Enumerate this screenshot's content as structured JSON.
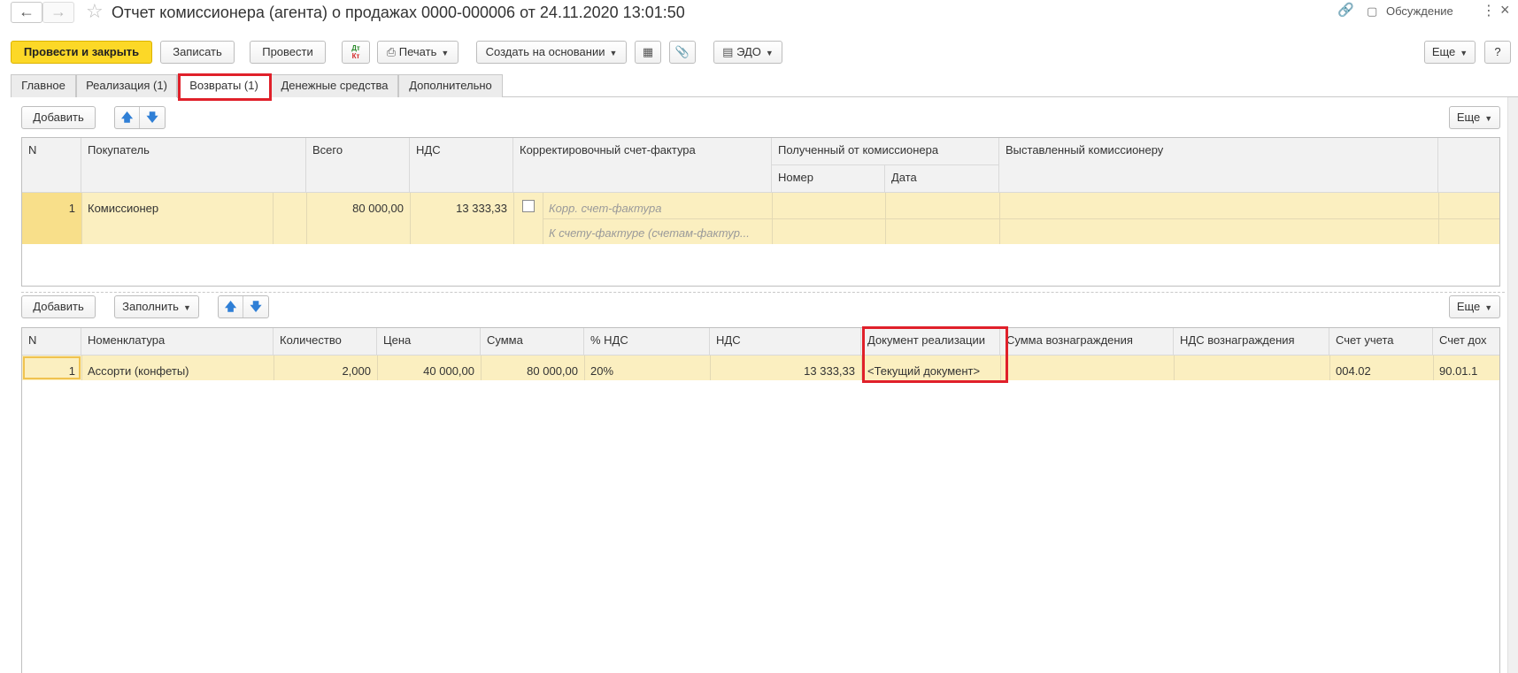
{
  "window": {
    "title": "Отчет комиссионера (агента) о продажах 0000-000006 от 24.11.2020 13:01:50",
    "back_icon": "arrow-left-icon",
    "forward_icon": "arrow-right-icon",
    "favorite_icon": "star-icon",
    "link_icon": "link-icon",
    "discussion_label": "Обсуждение",
    "menu_icon": "vertical-dots-icon",
    "close_icon": "close-icon"
  },
  "toolbar": {
    "post_close_label": "Провести и закрыть",
    "save_label": "Записать",
    "post_label": "Провести",
    "dtkt_icon": "dt-kt-icon",
    "dt_text": "Дт",
    "kt_text": "Кт",
    "print_label": "Печать",
    "create_based_label": "Создать на основании",
    "structure_icon": "structure-icon",
    "attach_icon": "paperclip-icon",
    "edo_label": "ЭДО",
    "more_label": "Еще",
    "help_label": "?"
  },
  "tabs": [
    {
      "label": "Главное"
    },
    {
      "label": "Реализация (1)"
    },
    {
      "label": "Возвраты (1)",
      "active": true
    },
    {
      "label": "Денежные средства"
    },
    {
      "label": "Дополнительно"
    }
  ],
  "returns_panel": {
    "add_label": "Добавить",
    "more_label": "Еще",
    "up_icon": "arrow-up-icon",
    "down_icon": "arrow-down-icon",
    "headers": {
      "n": "N",
      "buyer": "Покупатель",
      "total": "Всего",
      "vat": "НДС",
      "corr_invoice": "Корректировочный счет-фактура",
      "received": "Полученный от комиссионера",
      "number": "Номер",
      "date": "Дата",
      "issued": "Выставленный комиссионеру"
    },
    "rows": [
      {
        "n": "1",
        "buyer": "Комиссионер",
        "total": "80 000,00",
        "vat": "13 333,33",
        "corr_invoice_placeholder": "Корр. счет-фактура",
        "to_invoice_placeholder": "К счету-фактуре (счетам-фактур..."
      }
    ]
  },
  "goods_panel": {
    "add_label": "Добавить",
    "fill_label": "Заполнить",
    "more_label": "Еще",
    "headers": {
      "n": "N",
      "item": "Номенклатура",
      "qty": "Количество",
      "price": "Цена",
      "sum": "Сумма",
      "vat_rate": "% НДС",
      "vat": "НДС",
      "sale_doc": "Документ реализации",
      "fee_sum": "Сумма вознаграждения",
      "fee_vat": "НДС вознаграждения",
      "account": "Счет учета",
      "account2": "Счет дох"
    },
    "rows": [
      {
        "n": "1",
        "item": "Ассорти (конфеты)",
        "qty": "2,000",
        "price": "40 000,00",
        "sum": "80 000,00",
        "vat_rate": "20%",
        "vat": "13 333,33",
        "sale_doc": "<Текущий документ>",
        "fee_sum": "",
        "fee_vat": "",
        "account": "004.02",
        "account2": "90.01.1"
      }
    ]
  },
  "colors": {
    "accent_yellow": "#fcd827",
    "row_highlight": "#fbefc0",
    "annotation_red": "#e0202a"
  }
}
